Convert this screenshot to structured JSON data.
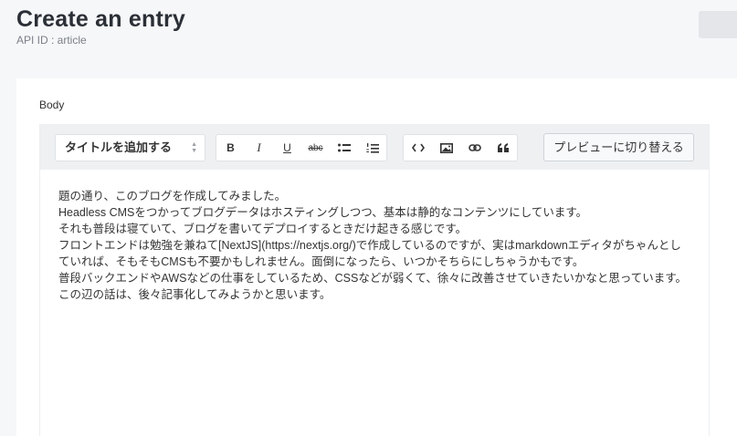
{
  "header": {
    "title": "Create an entry",
    "api_id": "API ID : article"
  },
  "field": {
    "label": "Body"
  },
  "toolbar": {
    "heading_select": "タイトルを追加する",
    "buttons": {
      "bold": "B",
      "italic": "I",
      "underline": "U",
      "strike": "abc"
    },
    "preview_label": "プレビューに切り替える"
  },
  "body_lines": [
    "題の通り、このブログを作成してみました。",
    "Headless CMSをつかってブログデータはホスティングしつつ、基本は静的なコンテンツにしています。",
    "それも普段は寝ていて、ブログを書いてデプロイするときだけ起きる感じです。",
    "フロントエンドは勉強を兼ねて[NextJS](https://nextjs.org/)で作成しているのですが、実はmarkdownエディタがちゃんとしていれば、そもそもCMSも不要かもしれません。面倒になったら、いつかそちらにしちゃうかもです。",
    "普段バックエンドやAWSなどの仕事をしているため、CSSなどが弱くて、徐々に改善させていきたいかなと思っています。",
    "この辺の話は、後々記事化してみようかと思います。"
  ]
}
